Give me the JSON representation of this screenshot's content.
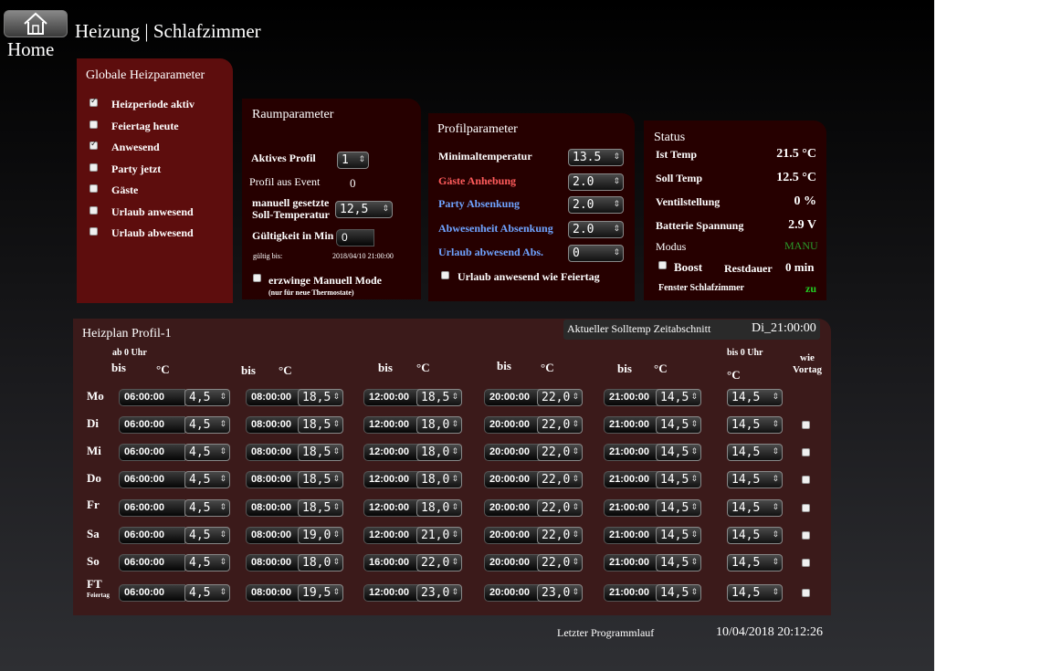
{
  "header": {
    "home_label": "Home",
    "title": "Heizung | Schlafzimmer"
  },
  "global": {
    "title": "Globale Heizparameter",
    "items": [
      {
        "label": "Heizperiode aktiv",
        "checked": true
      },
      {
        "label": "Feiertag heute",
        "checked": false
      },
      {
        "label": "Anwesend",
        "checked": true
      },
      {
        "label": "Party jetzt",
        "checked": false
      },
      {
        "label": "Gäste",
        "checked": false
      },
      {
        "label": "Urlaub anwesend",
        "checked": false
      },
      {
        "label": "Urlaub abwesend",
        "checked": false
      }
    ]
  },
  "room": {
    "title": "Raumparameter",
    "active_profile_label": "Aktives Profil",
    "active_profile_value": "1",
    "event_label": "Profil aus Event",
    "event_value": "0",
    "manual_label_1": "manuell gesetzte",
    "manual_label_2": "Soll-Temperatur",
    "manual_value": "12,5",
    "validity_label": "Gültigkeit in Min",
    "validity_value": "0",
    "valid_until_label": "gültig bis:",
    "valid_until_value": "2018/04/10 21:00:00",
    "force_label": "erzwinge Manuell Mode",
    "force_note": "(nur für neue Thermostate)"
  },
  "profile": {
    "title": "Profilparameter",
    "rows": [
      {
        "label": "Minimaltemperatur",
        "value": "13.5"
      },
      {
        "label": "Gäste Anhebung",
        "value": "2.0"
      },
      {
        "label": "Party Absenkung",
        "value": "2.0"
      },
      {
        "label": "Abwesenheit Absenkung",
        "value": "2.0"
      },
      {
        "label": "Urlaub abwesend Abs.",
        "value": "0"
      }
    ],
    "holiday_label": "Urlaub anwesend wie Feiertag"
  },
  "status": {
    "title": "Status",
    "rows": [
      {
        "label": "Ist Temp",
        "value": "21.5 °C"
      },
      {
        "label": "Soll Temp",
        "value": "12.5 °C"
      },
      {
        "label": "Ventilstellung",
        "value": "0 %"
      },
      {
        "label": "Batterie Spannung",
        "value": "2.9 V"
      }
    ],
    "mode_label": "Modus",
    "mode_value": "MANU",
    "boost_label": "Boost",
    "remaining_label": "Restdauer",
    "remaining_value": "0 min",
    "window_label": "Fenster Schlafzimmer",
    "window_value": "zu"
  },
  "plan": {
    "title": "Heizplan Profil-1",
    "current_label": "Aktueller Solltemp Zeitabschnitt",
    "current_value": "Di_21:00:00",
    "head": {
      "from_zero": "ab 0 Uhr",
      "bis": "bis",
      "deg": "°C",
      "bis_zero": "bis 0 Uhr",
      "wie": "wie",
      "vortag": "Vortag"
    },
    "days": [
      {
        "day": "Mo",
        "sub": "",
        "times": [
          "06:00:00",
          "08:00:00",
          "12:00:00",
          "20:00:00",
          "21:00:00"
        ],
        "temps": [
          "4,5",
          "18,5",
          "18,5",
          "22,0",
          "14,5",
          "14,5"
        ],
        "checkbox": false
      },
      {
        "day": "Di",
        "sub": "",
        "times": [
          "06:00:00",
          "08:00:00",
          "12:00:00",
          "20:00:00",
          "21:00:00"
        ],
        "temps": [
          "4,5",
          "18,5",
          "18,0",
          "22,0",
          "14,5",
          "14,5"
        ],
        "checkbox": true
      },
      {
        "day": "Mi",
        "sub": "",
        "times": [
          "06:00:00",
          "08:00:00",
          "12:00:00",
          "20:00:00",
          "21:00:00"
        ],
        "temps": [
          "4,5",
          "18,5",
          "18,0",
          "22,0",
          "14,5",
          "14,5"
        ],
        "checkbox": true
      },
      {
        "day": "Do",
        "sub": "",
        "times": [
          "06:00:00",
          "08:00:00",
          "12:00:00",
          "20:00:00",
          "21:00:00"
        ],
        "temps": [
          "4,5",
          "18,5",
          "18,0",
          "22,0",
          "14,5",
          "14,5"
        ],
        "checkbox": true
      },
      {
        "day": "Fr",
        "sub": "",
        "times": [
          "06:00:00",
          "08:00:00",
          "12:00:00",
          "20:00:00",
          "21:00:00"
        ],
        "temps": [
          "4,5",
          "18,5",
          "18,0",
          "22,0",
          "14,5",
          "14,5"
        ],
        "checkbox": true
      },
      {
        "day": "Sa",
        "sub": "",
        "times": [
          "06:00:00",
          "08:00:00",
          "12:00:00",
          "20:00:00",
          "21:00:00"
        ],
        "temps": [
          "4,5",
          "19,0",
          "21,0",
          "22,0",
          "14,5",
          "14,5"
        ],
        "checkbox": true
      },
      {
        "day": "So",
        "sub": "",
        "times": [
          "06:00:00",
          "08:00:00",
          "16:00:00",
          "20:00:00",
          "21:00:00"
        ],
        "temps": [
          "4,5",
          "18,0",
          "22,0",
          "22,0",
          "14,5",
          "14,5"
        ],
        "checkbox": true
      },
      {
        "day": "FT",
        "sub": "Feiertag",
        "times": [
          "06:00:00",
          "08:00:00",
          "12:00:00",
          "20:00:00",
          "21:00:00"
        ],
        "temps": [
          "4,5",
          "19,5",
          "23,0",
          "23,0",
          "14,5",
          "14,5"
        ],
        "checkbox": true
      }
    ]
  },
  "footer": {
    "last_run_label": "Letzter Programmlauf",
    "last_run_value": "10/04/2018 20:12:26"
  }
}
